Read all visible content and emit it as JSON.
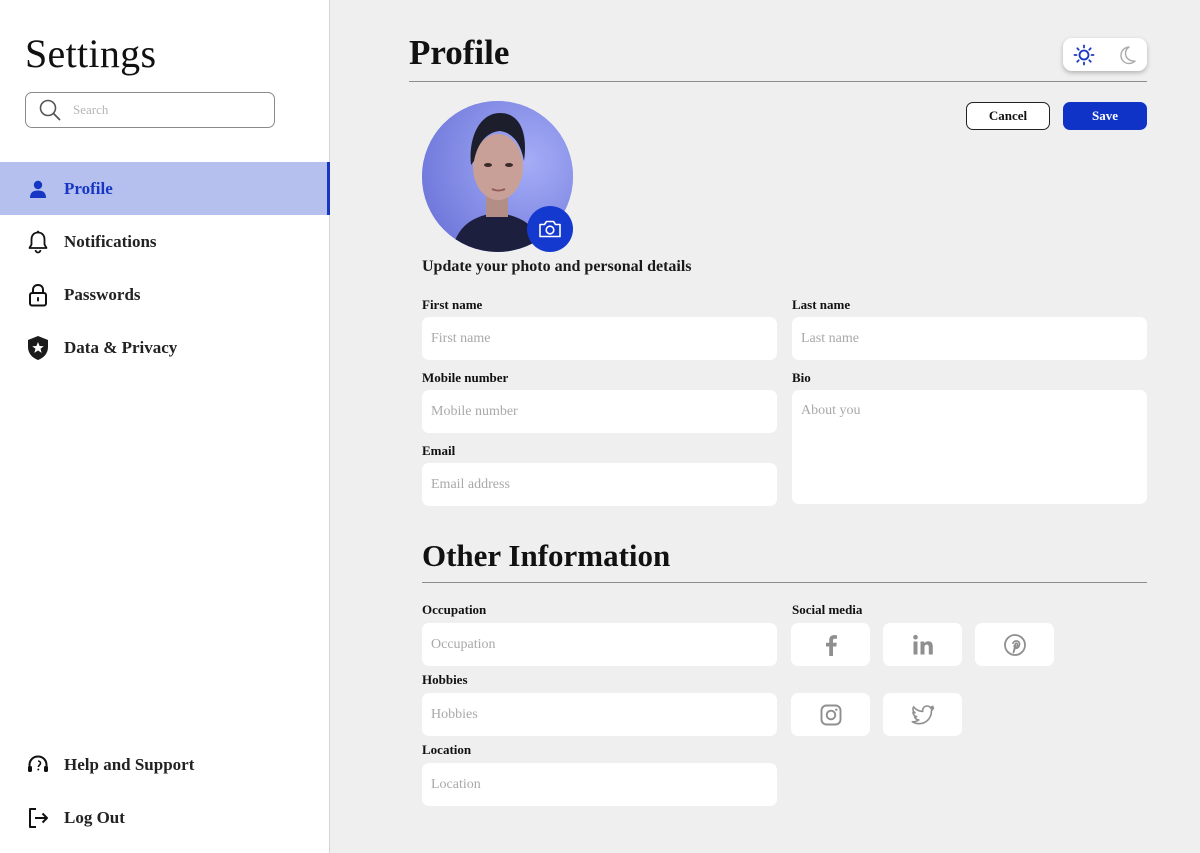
{
  "sidebar": {
    "title": "Settings",
    "search_placeholder": "Search",
    "items": [
      {
        "label": "Profile",
        "icon": "person-icon",
        "active": true
      },
      {
        "label": "Notifications",
        "icon": "bell-icon"
      },
      {
        "label": "Passwords",
        "icon": "lock-icon"
      },
      {
        "label": "Data & Privacy",
        "icon": "shield-star-icon"
      }
    ],
    "bottom_items": [
      {
        "label": "Help and Support",
        "icon": "headset-icon"
      },
      {
        "label": "Log Out",
        "icon": "logout-icon"
      }
    ]
  },
  "header": {
    "title": "Profile",
    "theme_toggle": {
      "light_icon": "sun-icon",
      "dark_icon": "moon-icon",
      "selected": "light"
    }
  },
  "actions": {
    "cancel_label": "Cancel",
    "save_label": "Save"
  },
  "profile": {
    "photo_icon": "camera-icon",
    "subtitle": "Update your photo and personal details",
    "fields": {
      "first_name": {
        "label": "First name",
        "placeholder": "First name"
      },
      "last_name": {
        "label": "Last name",
        "placeholder": "Last name"
      },
      "mobile": {
        "label": "Mobile number",
        "placeholder": "Mobile number"
      },
      "bio": {
        "label": "Bio",
        "placeholder": "About you"
      },
      "email": {
        "label": "Email",
        "placeholder": "Email address"
      }
    }
  },
  "other": {
    "title": "Other Information",
    "fields": {
      "occupation": {
        "label": "Occupation",
        "placeholder": "Occupation"
      },
      "hobbies": {
        "label": "Hobbies",
        "placeholder": "Hobbies"
      },
      "location": {
        "label": "Location",
        "placeholder": "Location"
      }
    },
    "social_label": "Social media",
    "social_icons": [
      "facebook-icon",
      "linkedin-icon",
      "pinterest-icon",
      "instagram-icon",
      "twitter-icon"
    ]
  },
  "colors": {
    "accent": "#1736c4",
    "active_bg": "#b5c0ee",
    "page_bg": "#efefef",
    "icon_gray": "#8f8f8f"
  }
}
